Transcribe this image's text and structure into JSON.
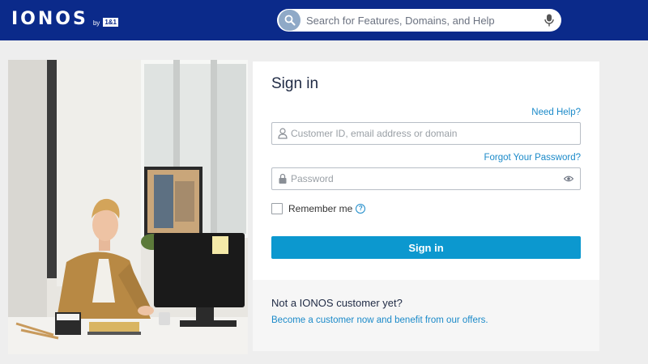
{
  "header": {
    "logo_text": "IONOS",
    "logo_by": "by",
    "logo_badge": "1&1",
    "search_placeholder": "Search for Features, Domains, and Help",
    "brand_color": "#0b2a8a"
  },
  "signin": {
    "title": "Sign in",
    "need_help": "Need Help?",
    "user_placeholder": "Customer ID, email address or domain",
    "forgot_password": "Forgot Your Password?",
    "password_placeholder": "Password",
    "remember_me": "Remember me",
    "remember_checked": false,
    "help_mark": "?",
    "button_label": "Sign in",
    "button_color": "#0c98cf"
  },
  "promo": {
    "title": "Not a IONOS customer yet?",
    "link": "Become a customer now and benefit from our offers."
  },
  "icons": [
    "search-icon",
    "microphone-icon",
    "user-icon",
    "lock-icon",
    "eye-icon",
    "help-icon"
  ]
}
